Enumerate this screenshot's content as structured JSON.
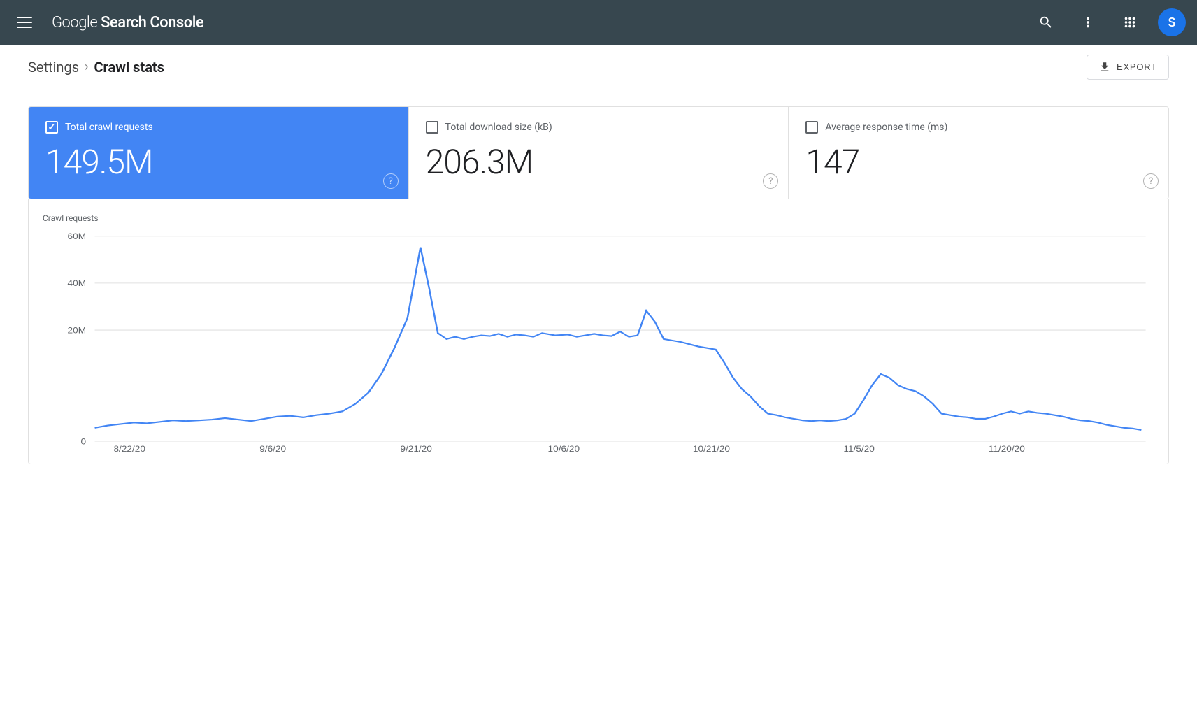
{
  "header": {
    "title_google": "Google ",
    "title_rest": "Search Console",
    "avatar_letter": "S",
    "avatar_bg": "#1a73e8"
  },
  "breadcrumb": {
    "settings_label": "Settings",
    "separator": "›",
    "current_label": "Crawl stats"
  },
  "toolbar": {
    "export_label": "EXPORT"
  },
  "stats": [
    {
      "id": "crawl_requests",
      "label": "Total crawl requests",
      "value": "149.5M",
      "active": true
    },
    {
      "id": "download_size",
      "label": "Total download size (kB)",
      "value": "206.3M",
      "active": false
    },
    {
      "id": "response_time",
      "label": "Average response time (ms)",
      "value": "147",
      "active": false
    }
  ],
  "chart": {
    "y_label": "Crawl requests",
    "y_axis": [
      "60M",
      "40M",
      "20M",
      "0"
    ],
    "x_axis": [
      "8/22/20",
      "9/6/20",
      "9/21/20",
      "10/6/20",
      "10/21/20",
      "11/5/20",
      "11/20/20"
    ],
    "accent_color": "#4285f4"
  }
}
